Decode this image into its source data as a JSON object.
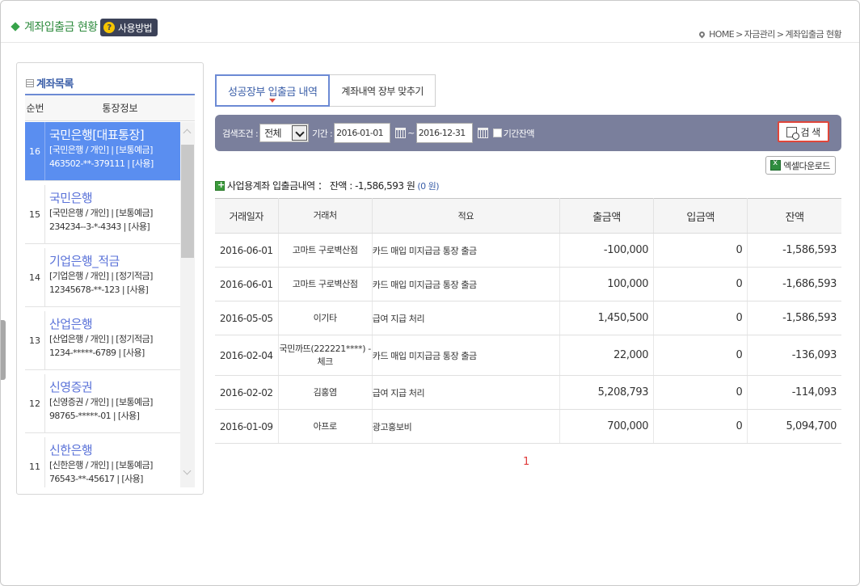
{
  "header": {
    "title": "계좌입출금 현황",
    "help_label": "사용방법",
    "breadcrumb": [
      "HOME",
      "자금관리",
      "계좌입출금 현황"
    ],
    "breadcrumb_sep": ">"
  },
  "accounts_panel": {
    "title": "계좌목록",
    "col_num": "순번",
    "col_info": "통장정보",
    "items": [
      {
        "num": "16",
        "bank": "국민은행[대표통장]",
        "line1": "[국민은행 / 개인] | [보통예금]",
        "line2": "463502-**-379111 | [사용]",
        "active": true
      },
      {
        "num": "15",
        "bank": "국민은행",
        "line1": "[국민은행 / 개인] | [보통예금]",
        "line2": "234234--3-*-4343 | [사용]"
      },
      {
        "num": "14",
        "bank": "기업은행_적금",
        "line1": "[기업은행 / 개인] | [정기적금]",
        "line2": "12345678-**-123 | [사용]"
      },
      {
        "num": "13",
        "bank": "산업은행",
        "line1": "[산업은행 / 개인] | [정기적금]",
        "line2": "1234-*****-6789 | [사용]"
      },
      {
        "num": "12",
        "bank": "신영증권",
        "line1": "[신영증권 / 개인] | [보통예금]",
        "line2": "98765-*****-01 | [사용]"
      },
      {
        "num": "11",
        "bank": "신한은행",
        "line1": "[신한은행 / 개인] | [보통예금]",
        "line2": "76543-**-45617 | [사용]"
      }
    ]
  },
  "tabs": [
    {
      "label": "성공장부 입출금 내역",
      "active": true
    },
    {
      "label": "계좌내역 장부 맞추기",
      "active": false
    }
  ],
  "search": {
    "condition_label": "검색조건 :",
    "condition_value": "전체",
    "period_label": "기간 :",
    "start_date": "2016-01-01",
    "end_date": "2016-12-31",
    "range_sep": "~",
    "balance_label": "기간잔액",
    "search_button": "검 색"
  },
  "excel_button": "엑셀다운로드",
  "caption": {
    "text": "사업용계좌 입출금내역 ： 잔액 : -1,586,593 원",
    "zero": "(0 원)"
  },
  "table": {
    "headers": [
      "거래일자",
      "거래처",
      "적요",
      "출금액",
      "입금액",
      "잔액"
    ],
    "rows": [
      {
        "date": "2016-06-01",
        "party": "고마트 구로벽산점",
        "memo": "카드 매입 미지급금 통장 출금",
        "out": "-100,000",
        "in": "0",
        "bal": "-1,586,593"
      },
      {
        "date": "2016-06-01",
        "party": "고마트 구로벽산점",
        "memo": "카드 매입 미지급금 통장 출금",
        "out": "100,000",
        "in": "0",
        "bal": "-1,686,593"
      },
      {
        "date": "2016-05-05",
        "party": "이기타",
        "memo": "급여 지급 처리",
        "out": "1,450,500",
        "in": "0",
        "bal": "-1,586,593"
      },
      {
        "date": "2016-02-04",
        "party": "국민까뜨(222221****) -체크",
        "memo": "카드 매입 미지급금 통장 출금",
        "out": "22,000",
        "in": "0",
        "bal": "-136,093"
      },
      {
        "date": "2016-02-02",
        "party": "김홍염",
        "memo": "급여 지급 처리",
        "out": "5,208,793",
        "in": "0",
        "bal": "-114,093"
      },
      {
        "date": "2016-01-09",
        "party": "아프로",
        "memo": "광고홍보비",
        "out": "700,000",
        "in": "0",
        "bal": "5,094,700"
      }
    ]
  },
  "pagination": {
    "current": "1"
  },
  "colors": {
    "accent": "#5a8ef0",
    "title_green": "#2e8b3e",
    "search_bar": "#7a7f9c",
    "page_red": "#e03a3a"
  }
}
